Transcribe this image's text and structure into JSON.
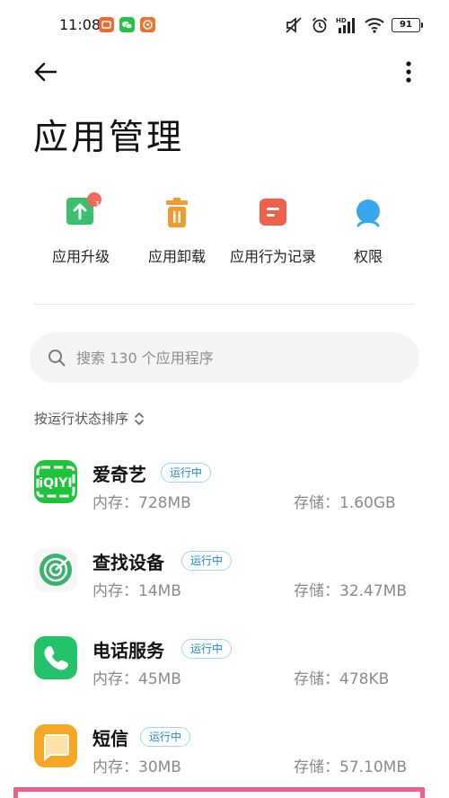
{
  "status_bar": {
    "time": "11:08",
    "battery": "91",
    "notif_colors": [
      "#f06a2e",
      "#25c449",
      "#f0722a"
    ]
  },
  "header": {
    "back_icon": "back-arrow-icon",
    "more_icon": "more-vertical-icon"
  },
  "page_title": "应用管理",
  "quick_actions": [
    {
      "label": "应用升级",
      "icon": "upgrade-icon",
      "badge": "11",
      "color": "#3bbf6e"
    },
    {
      "label": "应用卸载",
      "icon": "uninstall-trash-icon",
      "color": "#f39a2f"
    },
    {
      "label": "应用行为记录",
      "icon": "behavior-record-icon",
      "color": "#f0604a"
    },
    {
      "label": "权限",
      "icon": "permission-icon",
      "color": "#3aa6f0"
    }
  ],
  "search": {
    "placeholder": "搜索 130 个应用程序"
  },
  "sort": {
    "label": "按运行状态排序"
  },
  "apps": [
    {
      "name": "爱奇艺",
      "status": "运行中",
      "memory": "内存：728MB",
      "storage": "存储：1.60GB",
      "icon": "iqiyi-app-icon",
      "color": "#20c43a"
    },
    {
      "name": "查找设备",
      "status": "运行中",
      "memory": "内存：14MB",
      "storage": "存储：32.47MB",
      "icon": "find-device-app-icon",
      "color": "#37b36b"
    },
    {
      "name": "电话服务",
      "status": "运行中",
      "memory": "内存：45MB",
      "storage": "存储：478KB",
      "icon": "phone-service-app-icon",
      "color": "#24c26a"
    },
    {
      "name": "短信",
      "status": "运行中",
      "memory": "内存：30MB",
      "storage": "存储：57.10MB",
      "icon": "messages-app-icon",
      "color": "#f5a623"
    }
  ],
  "colors": {
    "status_tag_text": "#1d8bc6",
    "status_tag_border": "#9fd7ee",
    "highlight_border": "#ee5e8a"
  }
}
